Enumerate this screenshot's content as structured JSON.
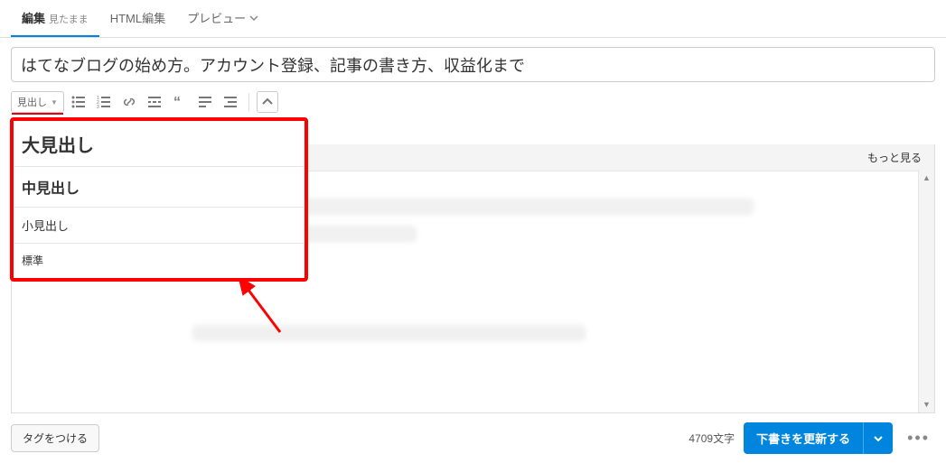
{
  "tabs": {
    "edit": "編集",
    "edit_sub": "見たまま",
    "html": "HTML編集",
    "preview": "プレビュー"
  },
  "title": "はてなブログの始め方。アカウント登録、記事の書き方、収益化まで",
  "toolbar": {
    "heading_label": "見出し"
  },
  "heading_options": {
    "h1": "大見出し",
    "h2": "中見出し",
    "h3": "小見出し",
    "p": "標準"
  },
  "more_link": "もっと見る",
  "footer": {
    "tag_button": "タグをつける",
    "char_count": "4709文字",
    "update_button": "下書きを更新する"
  }
}
